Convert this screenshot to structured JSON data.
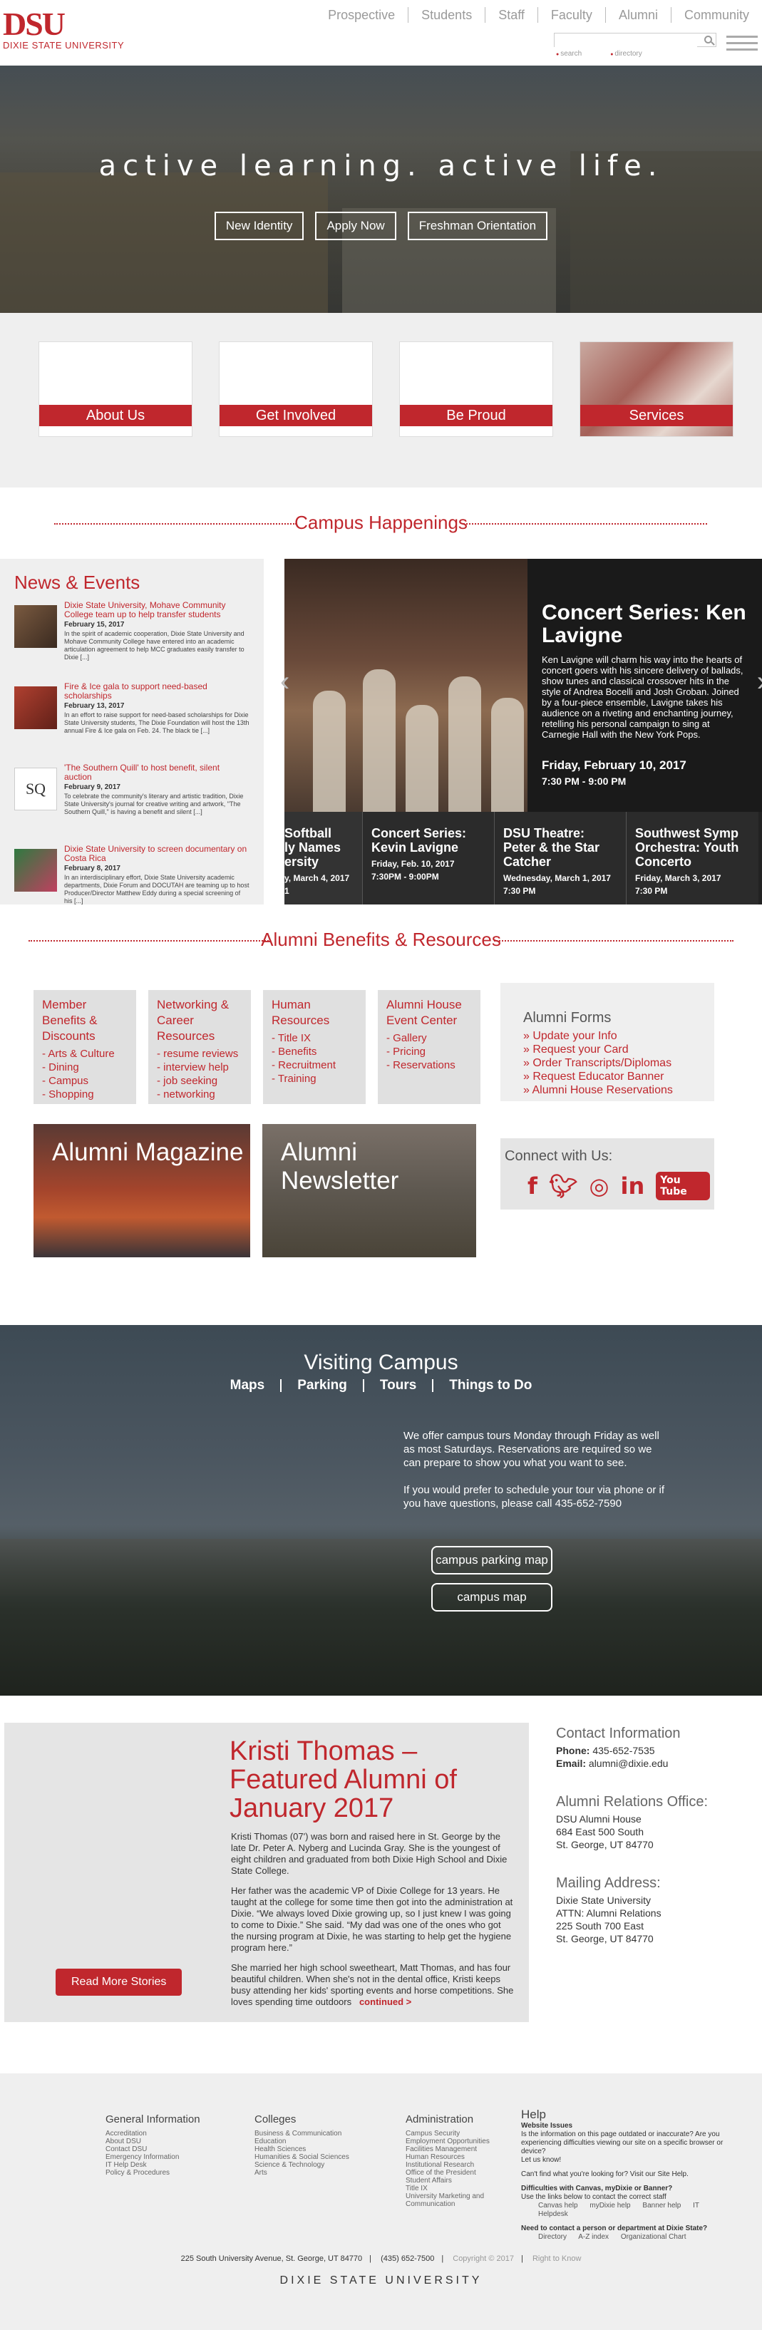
{
  "header": {
    "logo_mark": "DSU",
    "logo_name": "DIXIE STATE UNIVERSITY",
    "nav": [
      "Prospective",
      "Students",
      "Staff",
      "Faculty",
      "Alumni",
      "Community"
    ],
    "search_placeholder": "",
    "search_options": [
      "search",
      "directory"
    ]
  },
  "hero": {
    "tagline": "active learning. active life.",
    "buttons": [
      "New Identity",
      "Apply Now",
      "Freshman Orientation"
    ]
  },
  "cards": [
    "About Us",
    "Get Involved",
    "Be Proud",
    "Services"
  ],
  "happenings": {
    "title": "Campus Happenings",
    "news_title": "News & Events",
    "news": [
      {
        "title": "Dixie State University, Mohave Community College team up to help transfer students",
        "date": "February 15, 2017",
        "summary": "In the spirit of academic cooperation, Dixie State University and Mohave Community College have entered into an academic articulation agreement to help MCC graduates easily transfer to Dixie [...]"
      },
      {
        "title": "Fire & Ice gala to support need-based scholarships",
        "date": "February 13, 2017",
        "summary": "In an effort to raise support for need-based scholarships for Dixie State University students, The Dixie Foundation will host the 13th annual Fire & Ice gala on Feb. 24. The black tie [...]"
      },
      {
        "title": "'The Southern Quill' to host benefit, silent auction",
        "date": "February 9, 2017",
        "summary": "To celebrate the community's literary and artistic tradition, Dixie State University's journal for creative writing and artwork, \"The Southern Quill,\" is having a benefit and silent [...]"
      },
      {
        "title": "Dixie State University to screen documentary on Costa Rica",
        "date": "February 8, 2017",
        "summary": "In an interdisciplinary effort, Dixie State University academic departments, Dixie Forum and DOCUTAH are teaming up to host Producer/Director Matthew Eddy during a special screening of his [...]"
      }
    ],
    "feature": {
      "title": "Concert Series: Ken Lavigne",
      "description": "Ken Lavigne will charm his way into the hearts of concert goers with his sincere delivery of ballads, show tunes and classical crossover hits in the style of Andrea Bocelli and Josh Groban. Joined by a four-piece ensemble, Lavigne takes his audience on a riveting and enchanting journey, retelling his personal campaign to sing at Carnegie Hall with the New York Pops.",
      "date": "Friday, February 10, 2017",
      "time": "7:30 PM - 9:00 PM"
    },
    "events": [
      {
        "name": "Softball\nly Names\nersity",
        "date": "y, March 4, 2017",
        "time": "1"
      },
      {
        "name": "Concert Series: Kevin Lavigne",
        "date": "Friday, Feb. 10, 2017",
        "time": "7:30PM - 9:00PM"
      },
      {
        "name": "DSU Theatre: Peter & the Star Catcher",
        "date": "Wednesday, March 1, 2017",
        "time": "7:30 PM"
      },
      {
        "name": "Southwest Symp Orchestra: Youth Concerto",
        "date": "Friday, March 3, 2017",
        "time": "7:30 PM"
      }
    ]
  },
  "alumni": {
    "title": "Alumni Benefits & Resources",
    "benefits": [
      {
        "title": "Member Benefits & Discounts",
        "items": [
          "Arts & Culture",
          "Dining",
          "Campus",
          "Shopping"
        ]
      },
      {
        "title": "Networking & Career Resources",
        "items": [
          "resume reviews",
          "interview help",
          "job seeking",
          "networking"
        ]
      },
      {
        "title": "Human Resources",
        "items": [
          "Title IX",
          "Benefits",
          "Recruitment",
          "Training"
        ]
      },
      {
        "title": "Alumni House Event Center",
        "items": [
          "Gallery",
          "Pricing",
          "Reservations"
        ]
      }
    ],
    "forms_title": "Alumni Forms",
    "forms": [
      "Update your Info",
      "Request your Card",
      "Order Transcripts/Diplomas",
      "Request Educator Banner",
      "Alumni House Reservations"
    ],
    "magazine": "Alumni Magazine",
    "newsletter": "Alumni Newsletter",
    "connect_title": "Connect with Us:",
    "social": [
      "f",
      "t",
      "ig",
      "in",
      "You Tube"
    ]
  },
  "visit": {
    "title": "Visiting Campus",
    "nav": [
      "Maps",
      "Parking",
      "Tours",
      "Things to Do"
    ],
    "p1": "We offer campus tours Monday through Friday as well as most Saturdays. Reservations are required so we can prepare to show you what you want to see.",
    "p2": "If you would prefer to schedule your tour via phone or if you have questions, please call 435-652-7590",
    "btn_parking": "campus parking map",
    "btn_map": "campus map"
  },
  "featured": {
    "title": "Kristi Thomas – Featured Alumni of January 2017",
    "p1": "Kristi Thomas (07') was born and raised here in St. George by the late Dr. Peter A. Nyberg and Lucinda Gray. She is the youngest of eight children and graduated from both Dixie High School and Dixie State College.",
    "p2": "Her father was the academic VP of Dixie College for 13 years. He taught at the college for some time then got into the administration at Dixie. “We always loved Dixie growing up, so I just knew I was going to come to Dixie.” She said. “My dad was one of the ones who got the nursing program at Dixie, he was starting to help get the hygiene program here.”",
    "p3": "She married her high school sweetheart, Matt Thomas, and has four beautiful children. When she's not in the dental office, Kristi keeps busy attending her kids' sporting events and horse competitions. She loves spending time outdoors",
    "continued": "continued >",
    "more": "Read More Stories"
  },
  "contact": {
    "title": "Contact Information",
    "phone_label": "Phone:",
    "phone": "435-652-7535",
    "email_label": "Email:",
    "email": "alumni@dixie.edu",
    "office_title": "Alumni Relations Office:",
    "office": [
      "DSU Alumni House",
      "684 East 500 South",
      "St. George, UT 84770"
    ],
    "mail_title": "Mailing Address:",
    "mail": [
      "Dixie State University",
      "ATTN: Alumni Relations",
      "225 South 700 East",
      "St. George, UT 84770"
    ]
  },
  "footer": {
    "cols": [
      {
        "title": "General Information",
        "items": [
          "Accreditation",
          "About DSU",
          "Contact DSU",
          "Emergency Information",
          "IT Help Desk",
          "Policy & Procedures"
        ]
      },
      {
        "title": "Colleges",
        "items": [
          "Business & Communication",
          "Education",
          "Health Sciences",
          "Humanities & Social Sciences",
          "Science & Technology",
          "Arts"
        ]
      },
      {
        "title": "Administration",
        "items": [
          "Campus Security",
          "Employment Opportunities",
          "Facilities Management",
          "Human Resources",
          "Institutional Research",
          "Office of the President",
          "Student Affairs",
          "Title IX",
          "University Marketing and Communication"
        ]
      }
    ],
    "help_title": "Help",
    "help_issues": "Website Issues",
    "help_q": "Is the information on this page outdated or inaccurate? Are you experiencing difficulties viewing our site on a specific browser or device?",
    "help_let": "Let us know!",
    "help_cant": "Can't find what you're looking for? Visit our Site Help.",
    "help_diff": "Difficulties with Canvas, myDixie or Banner?",
    "help_diff2": "Use the links below to contact the correct staff",
    "help_links1": [
      "Canvas help",
      "myDixie help",
      "Banner help",
      "IT Helpdesk"
    ],
    "help_need": "Need to contact a person or department at Dixie State?",
    "help_links2": [
      "Directory",
      "A-Z index",
      "Organizational Chart"
    ],
    "address": "225 South University Avenue, St. George, UT 84770",
    "phone": "(435) 652-7500",
    "copyright": "Copyright © 2017",
    "right": "Right to Know",
    "name": "DIXIE STATE UNIVERSITY"
  }
}
